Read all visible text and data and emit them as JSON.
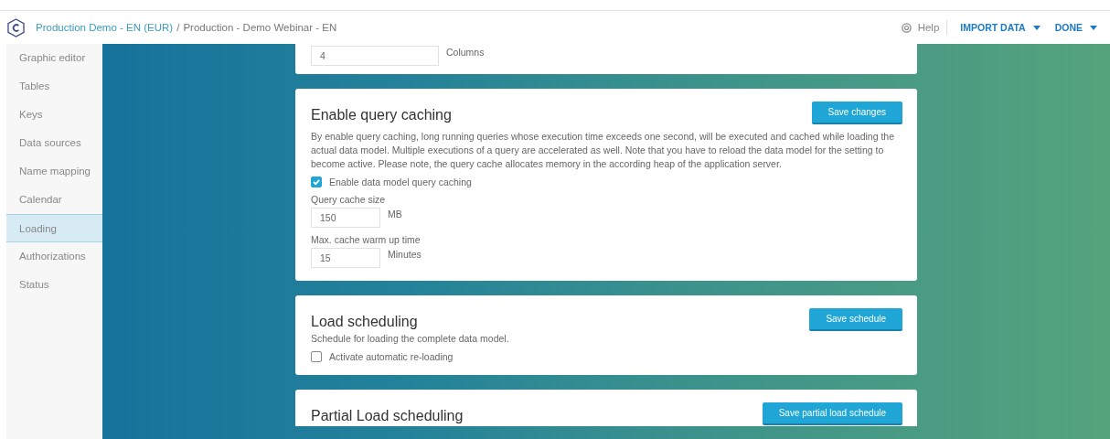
{
  "breadcrumb": {
    "project": "Production Demo - EN (EUR)",
    "separator": "/",
    "page": "Production - Demo Webinar - EN"
  },
  "toolbar": {
    "help": "Help",
    "actions": [
      {
        "label": "IMPORT DATA"
      },
      {
        "label": "DONE"
      }
    ]
  },
  "sidebar": {
    "items": [
      {
        "label": "Graphic editor",
        "selected": false
      },
      {
        "label": "Tables",
        "selected": false
      },
      {
        "label": "Keys",
        "selected": false
      },
      {
        "label": "Data sources",
        "selected": false
      },
      {
        "label": "Name mapping",
        "selected": false
      },
      {
        "label": "Calendar",
        "selected": false
      },
      {
        "label": "Loading",
        "selected": true
      },
      {
        "label": "Authorizations",
        "selected": false
      },
      {
        "label": "Status",
        "selected": false
      }
    ]
  },
  "cards": [
    {
      "kind": "partial-top",
      "field": {
        "value": "4",
        "unit": "Columns"
      }
    },
    {
      "kind": "full",
      "title": "Enable query caching",
      "button": "Save changes",
      "description": "By enable query caching, long running queries whose execution time exceeds one second, will be executed and cached while loading the actual data model. Multiple executions of a query are accelerated as well. Note that you have to reload the data model for the setting to become active. Please note, the query cache allocates memory in the according heap of the application server.",
      "checkbox": {
        "label": "Enable data model query caching",
        "checked": true
      },
      "fields": [
        {
          "label": "Query cache size",
          "value": "150",
          "unit": "MB"
        },
        {
          "label": "Max. cache warm up time",
          "value": "15",
          "unit": "Minutes"
        }
      ]
    },
    {
      "kind": "full",
      "title": "Load scheduling",
      "button": "Save schedule",
      "description": "Schedule for loading the complete data model.",
      "checkbox": {
        "label": "Activate automatic re-loading",
        "checked": false
      }
    },
    {
      "kind": "partial-bottom",
      "title": "Partial Load scheduling",
      "button": "Save partial load schedule"
    }
  ]
}
